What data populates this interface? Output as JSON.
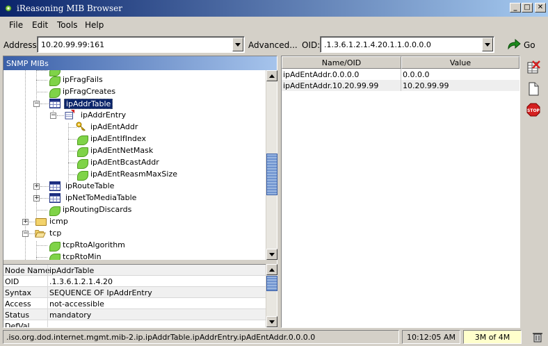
{
  "window": {
    "title": "iReasoning MIB Browser",
    "minimize_glyph": "_",
    "maximize_glyph": "□",
    "close_glyph": "✕"
  },
  "menu": [
    "File",
    "Edit",
    "Tools",
    "Help"
  ],
  "address_bar": {
    "address_label": "Address:",
    "address_value": "10.20.99.99:161",
    "advanced_label": "Advanced...",
    "oid_label": "OID:",
    "oid_value": ".1.3.6.1.2.1.4.20.1.1.0.0.0.0",
    "go_label": "Go"
  },
  "left_panel": {
    "title": "SNMP MIBs",
    "tree": [
      {
        "label": "ipFragFails",
        "icon": "leaf-icon"
      },
      {
        "label": "ipFragCreates",
        "icon": "leaf-icon"
      },
      {
        "label": "ipAddrTable",
        "icon": "table-icon",
        "selected": true,
        "expanded": true
      },
      {
        "label": "ipAddrEntry",
        "icon": "entry-icon",
        "expanded": true
      },
      {
        "label": "ipAdEntAddr",
        "icon": "key-icon"
      },
      {
        "label": "ipAdEntIfIndex",
        "icon": "leaf-icon"
      },
      {
        "label": "ipAdEntNetMask",
        "icon": "leaf-icon"
      },
      {
        "label": "ipAdEntBcastAddr",
        "icon": "leaf-icon"
      },
      {
        "label": "ipAdEntReasmMaxSize",
        "icon": "leaf-icon"
      },
      {
        "label": "ipRouteTable",
        "icon": "table-icon",
        "expanded": false
      },
      {
        "label": "ipNetToMediaTable",
        "icon": "table-icon",
        "expanded": false
      },
      {
        "label": "ipRoutingDiscards",
        "icon": "leaf-icon"
      },
      {
        "label": "icmp",
        "icon": "folder-icon",
        "expanded": false
      },
      {
        "label": "tcp",
        "icon": "folder-open-icon",
        "expanded": true
      },
      {
        "label": "tcpRtoAlgorithm",
        "icon": "leaf-icon"
      },
      {
        "label": "tcpRtoMin",
        "icon": "leaf-icon"
      }
    ],
    "properties": [
      {
        "key": "Node Name",
        "value": "ipAddrTable"
      },
      {
        "key": "OID",
        "value": ".1.3.6.1.2.1.4.20"
      },
      {
        "key": "Syntax",
        "value": "SEQUENCE OF IpAddrEntry"
      },
      {
        "key": "Access",
        "value": "not-accessible"
      },
      {
        "key": "Status",
        "value": "mandatory"
      },
      {
        "key": "DefVal",
        "value": ""
      }
    ]
  },
  "results_table": {
    "columns": [
      "Name/OID",
      "Value"
    ],
    "rows": [
      {
        "name": "ipAdEntAddr.0.0.0.0",
        "value": "0.0.0.0"
      },
      {
        "name": "ipAdEntAddr.10.20.99.99",
        "value": "10.20.99.99"
      }
    ]
  },
  "side_toolbar": [
    "clear-table-icon",
    "new-document-icon",
    "stop-icon"
  ],
  "status_bar": {
    "oid_path": ".iso.org.dod.internet.mgmt.mib-2.ip.ipAddrTable.ipAddrEntry.ipAdEntAddr.0.0.0.0",
    "time": "10:12:05 AM",
    "memory": "3M of 4M"
  },
  "colors": {
    "title_bar": "#0a246a",
    "selection": "#0a246a",
    "leaf_green": "#7fd348",
    "memory_bg": "#ffffcc",
    "stop_red": "#d42020"
  }
}
